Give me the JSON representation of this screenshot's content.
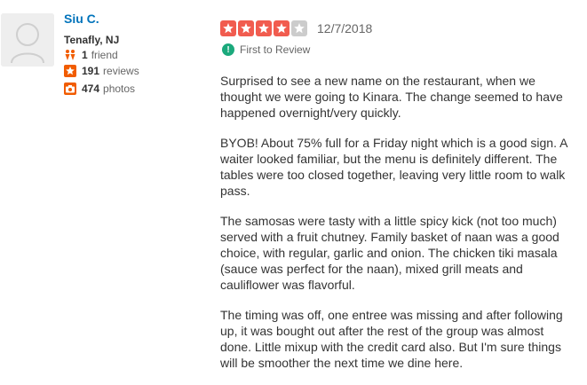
{
  "user": {
    "name": "Siu C.",
    "location": "Tenafly, NJ",
    "friends_count": "1",
    "friends_label": "friend",
    "reviews_count": "191",
    "reviews_label": "reviews",
    "photos_count": "474",
    "photos_label": "photos"
  },
  "review": {
    "rating": 4,
    "max_rating": 5,
    "date": "12/7/2018",
    "badge_label": "First to Review",
    "paragraphs": [
      "Surprised to see a new name on the restaurant, when we thought we were going to Kinara.  The change seemed to have happened overnight/very quickly.",
      "BYOB!  About 75% full for a Friday night which is a good sign.  A waiter looked familiar, but the menu is definitely different.  The tables were too closed together, leaving very little room to walk pass.",
      "The samosas were tasty with a little spicy kick (not too much) served with a fruit chutney.  Family basket of naan was a good choice, with regular, garlic and onion.  The chicken tiki masala (sauce was perfect for the naan), mixed grill meats and cauliflower was flavorful.",
      "The timing was off, one entree was missing and after following up, it was bought out after the rest of the group was almost done.  Little mixup with the credit card also.  But I'm sure things will be smoother the next time we dine here."
    ]
  },
  "colors": {
    "link": "#0073bb",
    "star_filled": "#f15c4f",
    "star_empty": "#cccccc",
    "friends_icon": "#f15c00",
    "reviews_icon": "#f15c00",
    "photos_icon": "#f15c00",
    "badge": "#1ba97c"
  },
  "icons": {
    "avatar": "default-user-avatar-icon",
    "friends": "friends-icon",
    "reviews": "star-box-icon",
    "photos": "camera-icon",
    "badge": "info-badge-icon",
    "star": "star-icon"
  }
}
